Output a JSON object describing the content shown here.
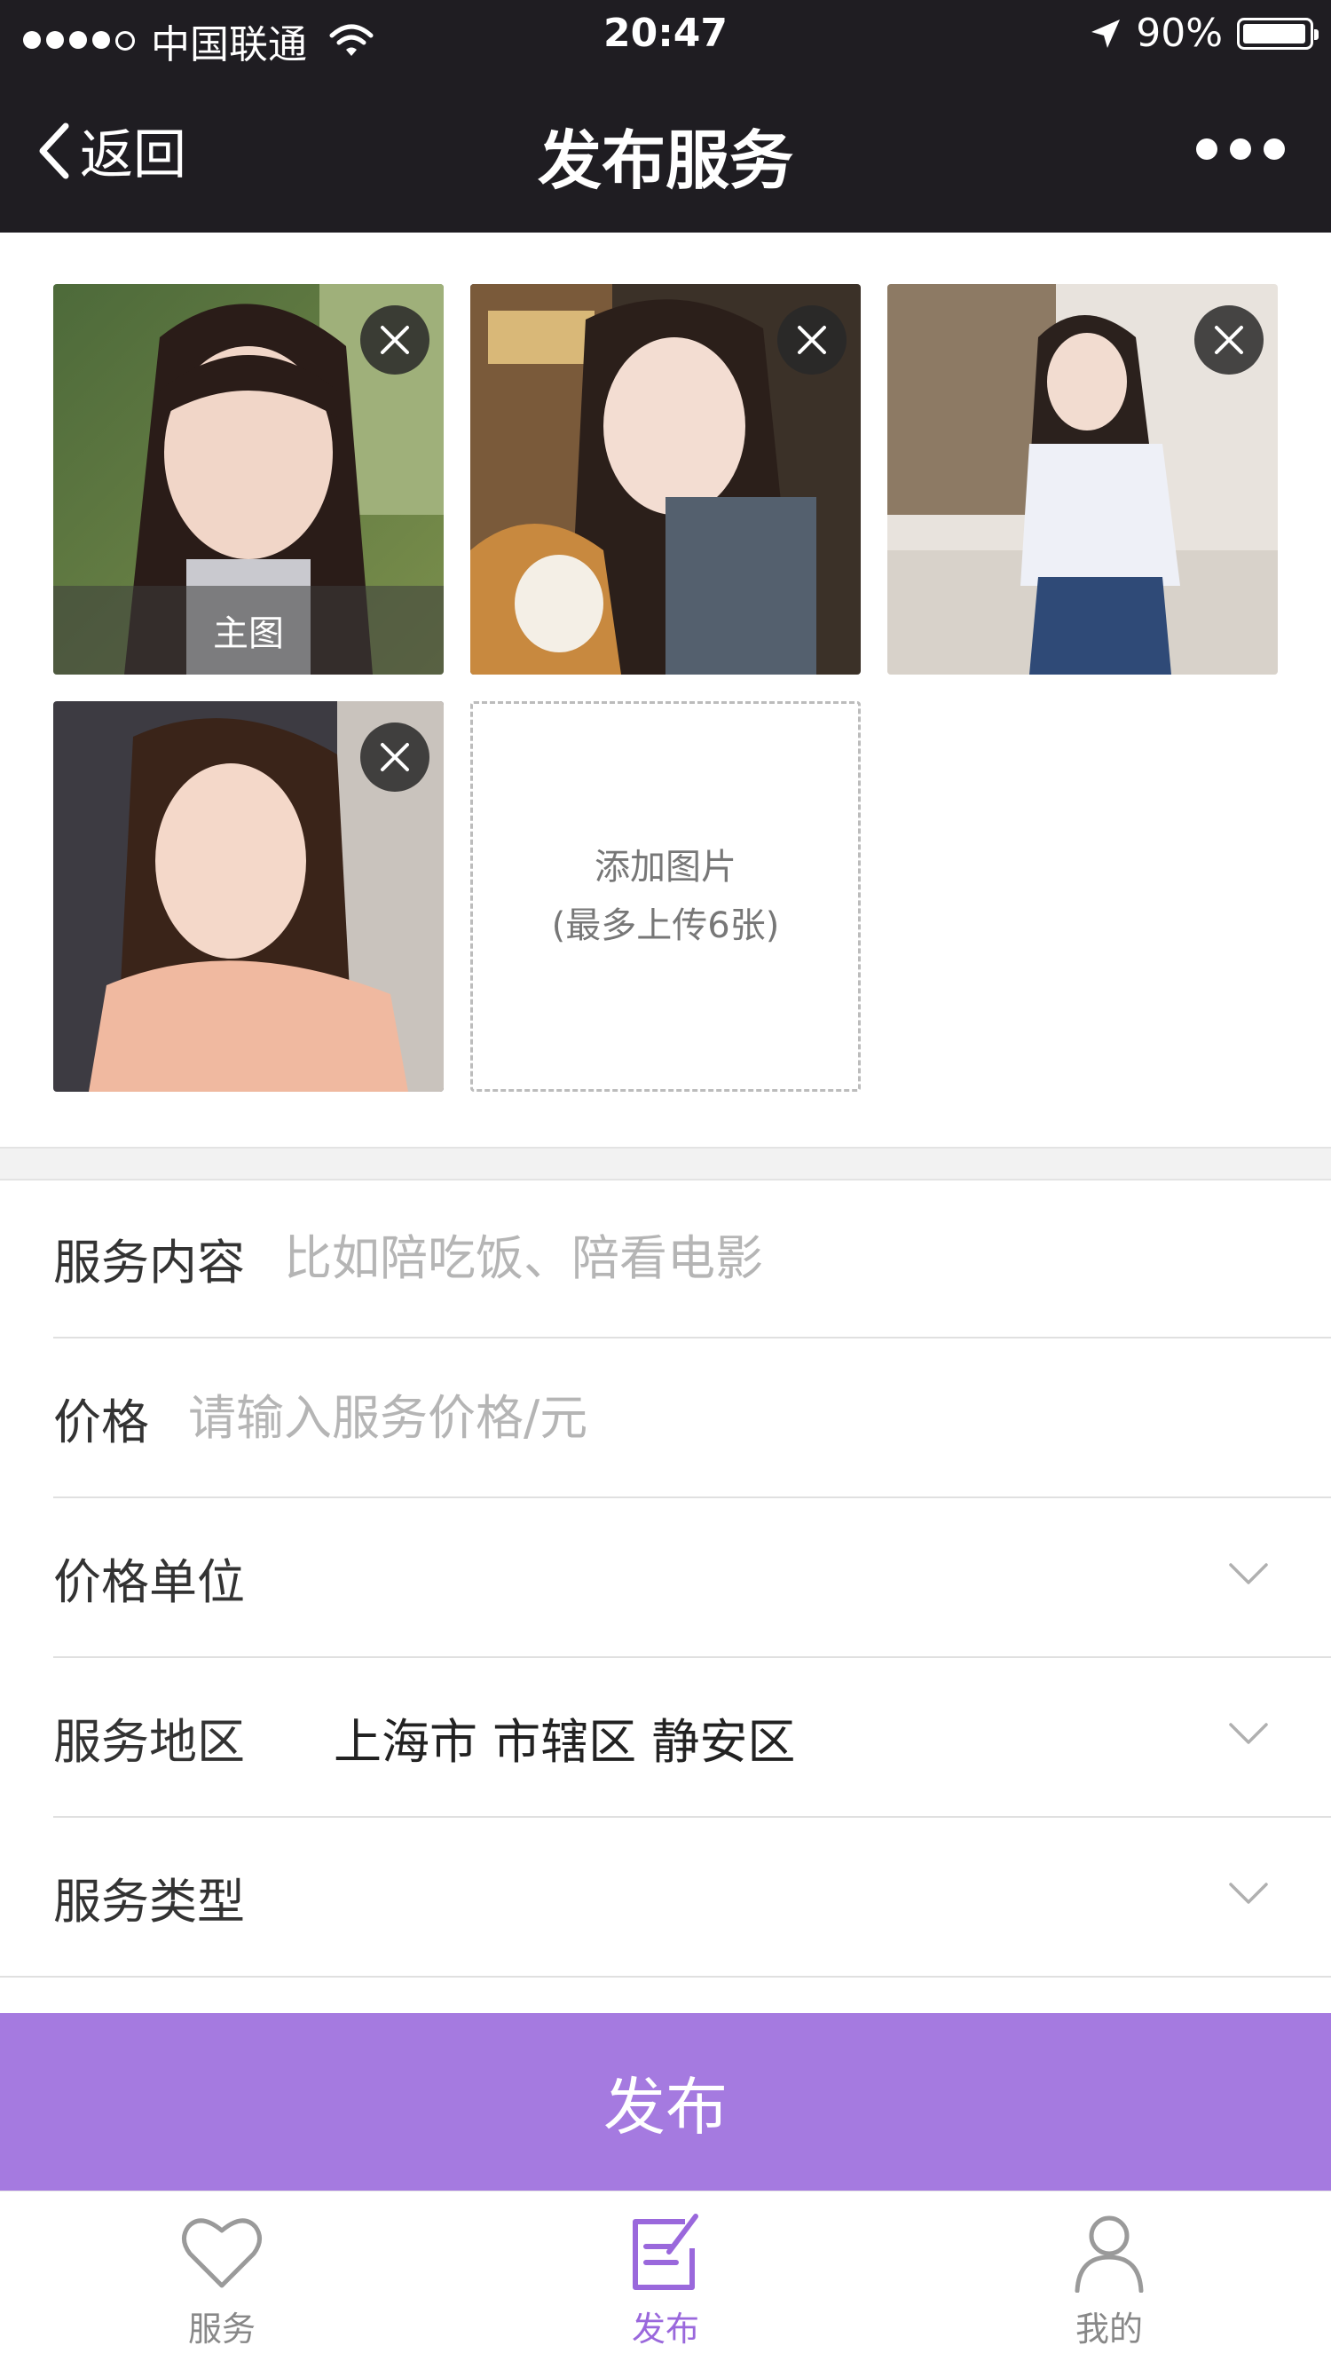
{
  "status_bar": {
    "carrier": "中国联通",
    "time": "20:47",
    "battery": "90%"
  },
  "nav": {
    "back_label": "返回",
    "title": "发布服务"
  },
  "photos": {
    "main_tag": "主图",
    "add_label": "添加图片",
    "add_hint": "(最多上传6张)"
  },
  "form": {
    "service_content": {
      "label": "服务内容",
      "placeholder": "比如陪吃饭、陪看电影"
    },
    "price": {
      "label": "价格",
      "placeholder": "请输入服务价格/元"
    },
    "price_unit": {
      "label": "价格单位"
    },
    "service_area": {
      "label": "服务地区",
      "value": "上海市 市辖区 静安区"
    },
    "service_type": {
      "label": "服务类型"
    }
  },
  "publish_button": "发布",
  "tabbar": {
    "items": [
      {
        "label": "服务"
      },
      {
        "label": "发布"
      },
      {
        "label": "我的"
      }
    ]
  },
  "colors": {
    "accent": "#a57ae0",
    "tab_active": "#9a68dc",
    "topbar": "#1f1d22"
  }
}
